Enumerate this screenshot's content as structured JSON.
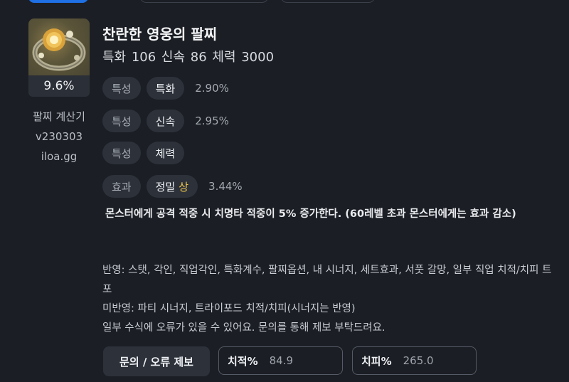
{
  "item": {
    "name": "찬란한 영웅의 팔찌",
    "stats_line": "특화 106  신속 86  체력 3000",
    "percent": "9.6%"
  },
  "meta": [
    "팔찌 계산기",
    "v230303",
    "iloa.gg"
  ],
  "options": [
    {
      "type": "특성",
      "name": "특화",
      "grade": "",
      "value": "2.90%"
    },
    {
      "type": "특성",
      "name": "신속",
      "grade": "",
      "value": "2.95%"
    },
    {
      "type": "특성",
      "name": "체력",
      "grade": "",
      "value": ""
    },
    {
      "type": "효과",
      "name": "정밀",
      "grade": "상",
      "value": "3.44%"
    }
  ],
  "effect_description": "몬스터에게 공격 적중 시 치명타 적중이 5% 증가한다. (60레벨 초과 몬스터에게는 효과 감소)",
  "notes": {
    "applied": "반영: 스탯, 각인, 직업각인, 특화계수, 팔찌옵션, 내 시너지, 세트효과, 서풋 갈망, 일부 직업 치적/치피 트포",
    "not_applied": "미반영: 파티 시너지, 트라이포드 치적/치피(시너지는 반영)",
    "disclaimer": "일부 수식에 오류가 있을 수 있어요. 문의를 통해 제보 부탁드려요."
  },
  "controls": {
    "report_button": "문의 / 오류 제보",
    "crit_rate_label": "치적%",
    "crit_rate_value": "84.9",
    "crit_dmg_label": "치피%",
    "crit_dmg_value": "265.0"
  },
  "colors": {
    "accent": "#1f6fe5",
    "highlight": "#f2c94c",
    "background": "#1b1e24"
  }
}
